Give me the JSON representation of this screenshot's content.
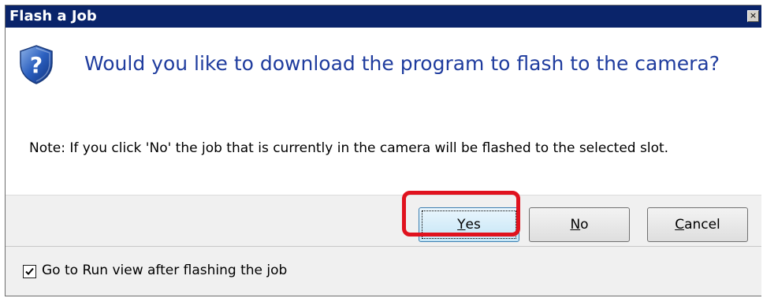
{
  "dialog": {
    "title": "Flash a Job",
    "close_glyph": "×",
    "icon": "shield-question-icon",
    "main_instruction": "Would you like to download the program to flash to the camera?",
    "note": "Note: If you click 'No' the job that is currently in the camera will be flashed to the selected slot."
  },
  "buttons": {
    "yes": {
      "accel": "Y",
      "rest": "es"
    },
    "no": {
      "accel": "N",
      "rest": "o"
    },
    "cancel": {
      "accel": "C",
      "rest": "ancel"
    }
  },
  "footer": {
    "checkbox_label": "Go to Run view after flashing the job",
    "checkbox_checked": true
  },
  "colors": {
    "title_bar": "#0a246a",
    "instruction_text": "#1f3c9e",
    "highlight": "#e0121e"
  }
}
